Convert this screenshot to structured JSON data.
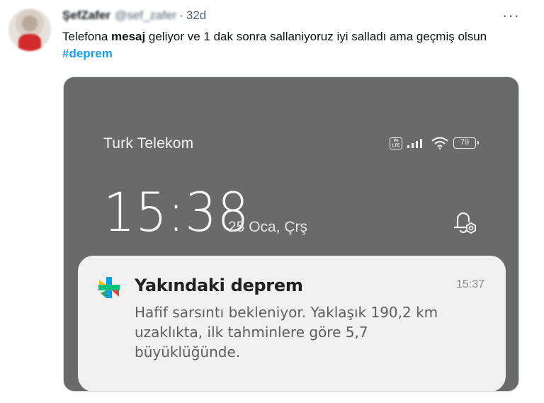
{
  "tweet": {
    "display_name": "ŞefZafer",
    "handle": "@sef_zafer",
    "separator": "·",
    "time": "32d",
    "more_icon": "more-horizontal-icon",
    "text_part1": "Telefona ",
    "text_bold": "mesaj",
    "text_part2": " geliyor ve 1 dak sonra sallaniyoruz iyi salladı ama geçmiş olsun ",
    "hashtag": "#deprem"
  },
  "phone": {
    "carrier": "Turk Telekom",
    "volte": "Vo LTE",
    "battery": "79",
    "clock": "15:38",
    "date": "25 Oca, Çrş",
    "notification": {
      "title": "Yakındaki deprem",
      "time": "15:37",
      "body": "Hafif sarsıntı bekleniyor. Yaklaşık 190,2 km uzaklıkta, ilk tahminlere göre 5,7 büyüklüğünde."
    }
  },
  "colors": {
    "hashtag": "#1d9bf0",
    "lockscreen_bg": "#6a6a6a",
    "notification_bg": "#f0f0f0"
  }
}
